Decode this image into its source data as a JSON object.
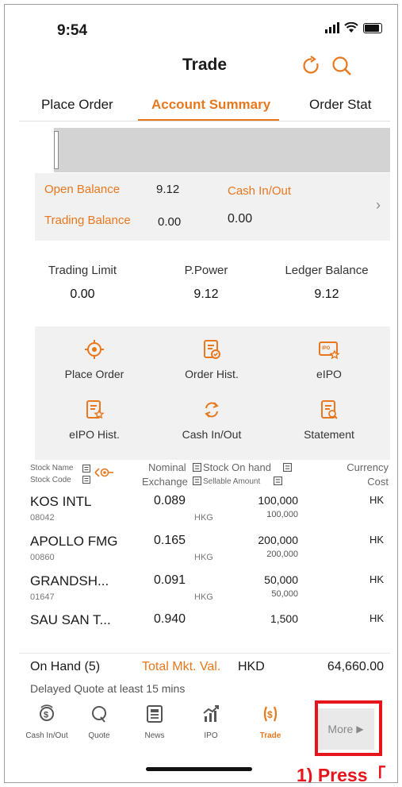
{
  "status_bar": {
    "time": "9:54"
  },
  "header": {
    "title": "Trade"
  },
  "tabs": [
    {
      "label": "Place Order"
    },
    {
      "label": "Account Summary"
    },
    {
      "label": "Order Stat"
    }
  ],
  "summary": {
    "open_balance_label": "Open Balance",
    "open_balance_value": "9.12",
    "cash_inout_label": "Cash In/Out",
    "cash_inout_value": "0.00",
    "trading_balance_label": "Trading Balance",
    "trading_balance_value": "0.00"
  },
  "limits": {
    "trading_limit_label": "Trading Limit",
    "trading_limit_value": "0.00",
    "ppower_label": "P.Power",
    "ppower_value": "9.12",
    "ledger_label": "Ledger Balance",
    "ledger_value": "9.12"
  },
  "menu": [
    {
      "label": "Place Order",
      "icon": "target-icon"
    },
    {
      "label": "Order Hist.",
      "icon": "document-check-icon"
    },
    {
      "label": "eIPO",
      "icon": "ipo-card-icon"
    },
    {
      "label": "eIPO Hist.",
      "icon": "document-star-icon"
    },
    {
      "label": "Cash In/Out",
      "icon": "transfer-icon"
    },
    {
      "label": "Statement",
      "icon": "document-search-icon"
    }
  ],
  "table_header": {
    "stock_name": "Stock Name",
    "stock_code": "Stock Code",
    "nominal": "Nominal",
    "exchange": "Exchange",
    "stock_on_hand": "Stock On hand",
    "sellable_amount": "Sellable Amount",
    "currency": "Currency",
    "cost": "Cost"
  },
  "holdings": [
    {
      "name": "KOS INTL",
      "code": "08042",
      "nominal": "0.089",
      "exchange": "HKG",
      "on_hand": "100,000",
      "sellable": "100,000",
      "currency": "HK"
    },
    {
      "name": "APOLLO FMG",
      "code": "00860",
      "nominal": "0.165",
      "exchange": "HKG",
      "on_hand": "200,000",
      "sellable": "200,000",
      "currency": "HK"
    },
    {
      "name": "GRANDSH...",
      "code": "01647",
      "nominal": "0.091",
      "exchange": "HKG",
      "on_hand": "50,000",
      "sellable": "50,000",
      "currency": "HK"
    },
    {
      "name": "SAU SAN T...",
      "code": "",
      "nominal": "0.940",
      "exchange": "",
      "on_hand": "1,500",
      "sellable": "",
      "currency": "HK"
    }
  ],
  "totals": {
    "on_hand_label": "On Hand (5)",
    "mkt_val_label": "Total Mkt. Val.",
    "currency": "HKD",
    "value": "64,660.00"
  },
  "delayed_note": "Delayed Quote at least 15 mins",
  "tabbar": [
    {
      "label": "Cash In/Out",
      "icon": "cash-icon"
    },
    {
      "label": "Quote",
      "icon": "quote-icon"
    },
    {
      "label": "News",
      "icon": "news-icon"
    },
    {
      "label": "IPO",
      "icon": "ipo-chart-icon"
    },
    {
      "label": "Trade",
      "icon": "trade-icon"
    }
  ],
  "more_button": {
    "label": "More",
    "arrow": "▶"
  },
  "annotation": {
    "text": "1)  Press「"
  },
  "colors": {
    "accent": "#e8781e",
    "highlight": "#e6141b"
  }
}
